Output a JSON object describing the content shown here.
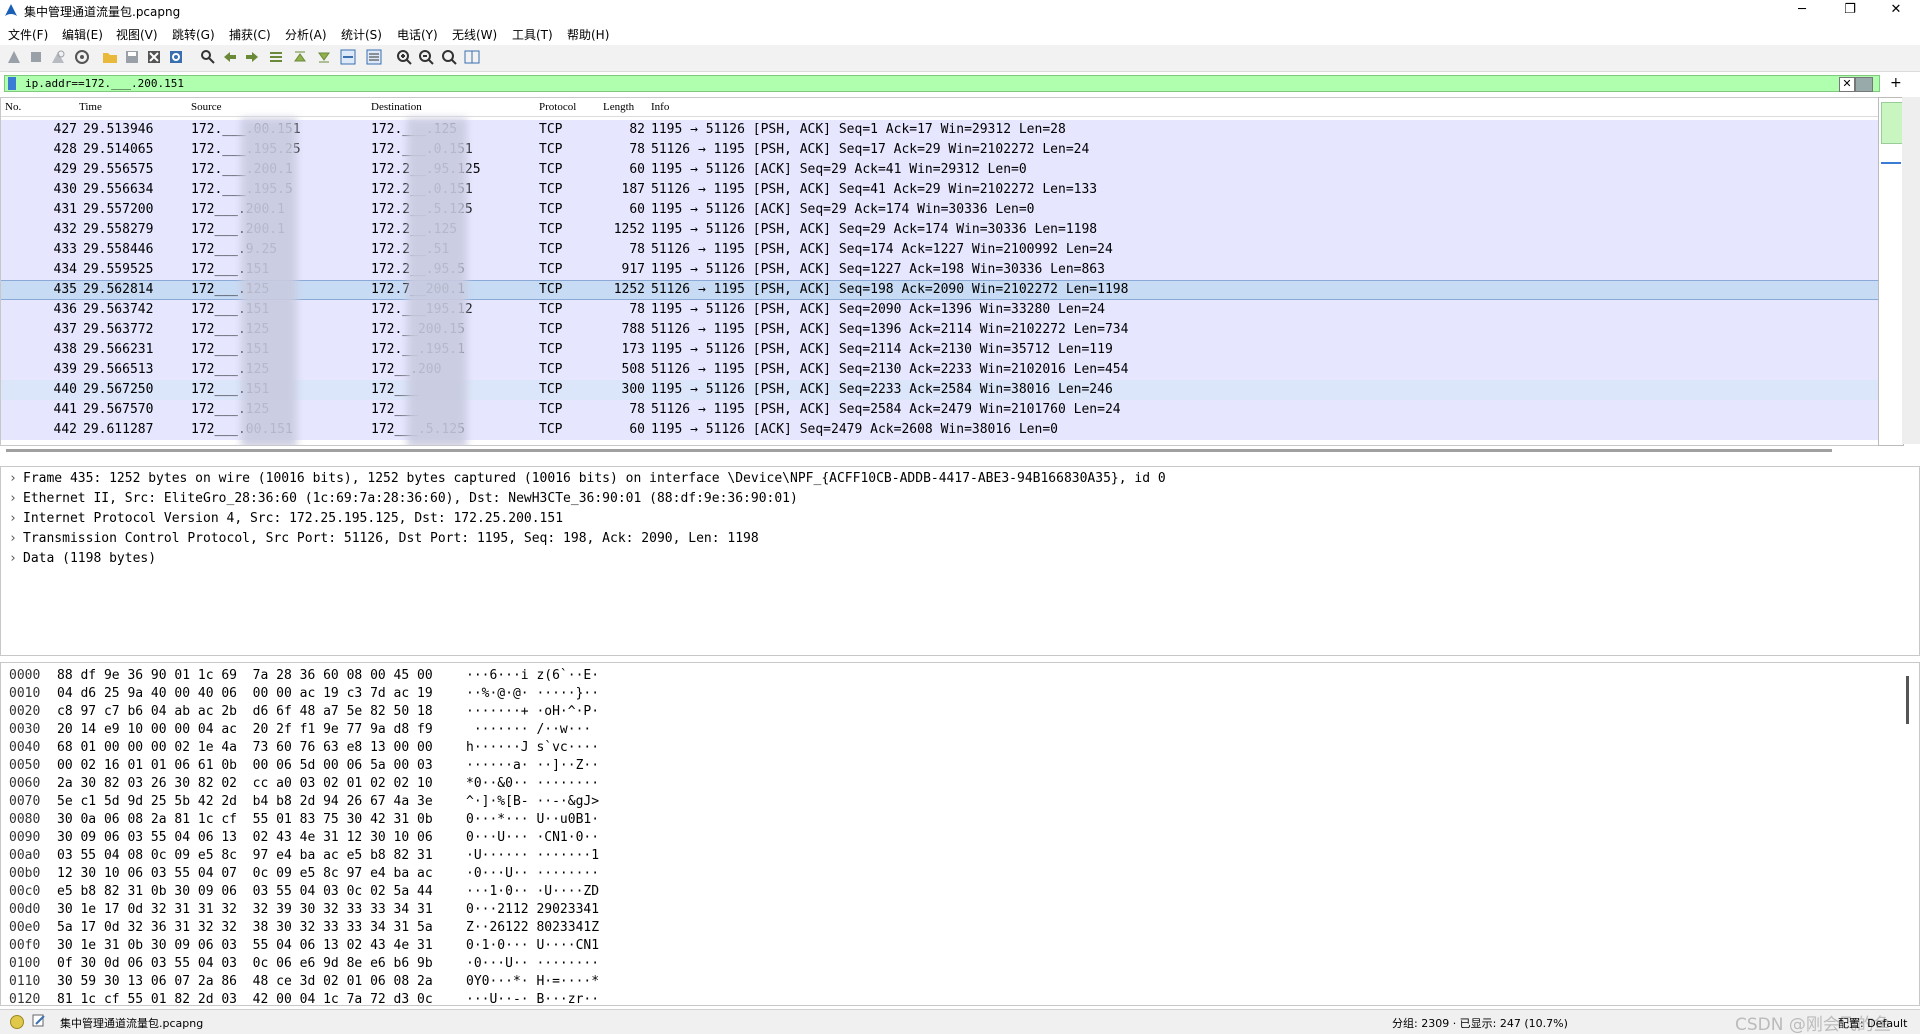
{
  "window": {
    "title": "集中管理通道流量包.pcapng",
    "minimize": "─",
    "maximize": "❐",
    "close": "✕"
  },
  "menu": [
    "文件(F)",
    "编辑(E)",
    "视图(V)",
    "跳转(G)",
    "捕获(C)",
    "分析(A)",
    "统计(S)",
    "电话(Y)",
    "无线(W)",
    "工具(T)",
    "帮助(H)"
  ],
  "toolbar_icons": [
    "shark-fin-start-icon",
    "stop-icon",
    "restart-icon",
    "options-gear-icon",
    "open-folder-icon",
    "save-file-icon",
    "close-file-icon",
    "reload-icon",
    "find-icon",
    "go-back-icon",
    "go-forward-icon",
    "go-to-packet-icon",
    "first-packet-icon",
    "last-packet-icon",
    "autoscroll-icon",
    "colorize-icon",
    "zoom-in-icon",
    "zoom-out-icon",
    "zoom-normal-icon",
    "resize-columns-icon"
  ],
  "filter": {
    "value": "ip.addr==172.___.200.151",
    "clear": "✕"
  },
  "packet_list": {
    "columns": [
      "No.",
      "Time",
      "Source",
      "Destination",
      "Protocol",
      "Length",
      "Info"
    ],
    "rows": [
      {
        "no": "427",
        "time": "29.513946",
        "src": "172.___.00.151",
        "dst": "172.___.125",
        "proto": "TCP",
        "len": "82",
        "info": "1195 → 51126 [PSH, ACK] Seq=1 Ack=17 Win=29312 Len=28"
      },
      {
        "no": "428",
        "time": "29.514065",
        "src": "172.___.195.25",
        "dst": "172.___.0.151",
        "proto": "TCP",
        "len": "78",
        "info": "51126 → 1195 [PSH, ACK] Seq=17 Ack=29 Win=2102272 Len=24"
      },
      {
        "no": "429",
        "time": "29.556575",
        "src": "172.___.200.1",
        "dst": "172.2__.95.125",
        "proto": "TCP",
        "len": "60",
        "info": "1195 → 51126 [ACK] Seq=29 Ack=41 Win=29312 Len=0"
      },
      {
        "no": "430",
        "time": "29.556634",
        "src": "172.___.195.5",
        "dst": "172.2__.0.151",
        "proto": "TCP",
        "len": "187",
        "info": "51126 → 1195 [PSH, ACK] Seq=41 Ack=29 Win=2102272 Len=133"
      },
      {
        "no": "431",
        "time": "29.557200",
        "src": "172___.200.1",
        "dst": "172.2__.5.125",
        "proto": "TCP",
        "len": "60",
        "info": "1195 → 51126 [ACK] Seq=29 Ack=174 Win=30336 Len=0"
      },
      {
        "no": "432",
        "time": "29.558279",
        "src": "172___.200.1",
        "dst": "172.2__.125",
        "proto": "TCP",
        "len": "1252",
        "info": "1195 → 51126 [PSH, ACK] Seq=29 Ack=174 Win=30336 Len=1198"
      },
      {
        "no": "433",
        "time": "29.558446",
        "src": "172___.9.25",
        "dst": "172.2__.51",
        "proto": "TCP",
        "len": "78",
        "info": "51126 → 1195 [PSH, ACK] Seq=174 Ack=1227 Win=2100992 Len=24"
      },
      {
        "no": "434",
        "time": "29.559525",
        "src": "172___.151",
        "dst": "172.2__.95.5",
        "proto": "TCP",
        "len": "917",
        "info": "1195 → 51126 [PSH, ACK] Seq=1227 Ack=198 Win=30336 Len=863"
      },
      {
        "no": "435",
        "time": "29.562814",
        "src": "172___.125",
        "dst": "172.7__200.1",
        "proto": "TCP",
        "len": "1252",
        "info": "51126 → 1195 [PSH, ACK] Seq=198 Ack=2090 Win=2102272 Len=1198"
      },
      {
        "no": "436",
        "time": "29.563742",
        "src": "172___.151",
        "dst": "172.___195.12",
        "proto": "TCP",
        "len": "78",
        "info": "1195 → 51126 [PSH, ACK] Seq=2090 Ack=1396 Win=33280 Len=24"
      },
      {
        "no": "437",
        "time": "29.563772",
        "src": "172___.125",
        "dst": "172.__200.15",
        "proto": "TCP",
        "len": "788",
        "info": "51126 → 1195 [PSH, ACK] Seq=1396 Ack=2114 Win=2102272 Len=734"
      },
      {
        "no": "438",
        "time": "29.566231",
        "src": "172___.151",
        "dst": "172.__.195.1",
        "proto": "TCP",
        "len": "173",
        "info": "1195 → 51126 [PSH, ACK] Seq=2114 Ack=2130 Win=35712 Len=119"
      },
      {
        "no": "439",
        "time": "29.566513",
        "src": "172___.125",
        "dst": "172__.200",
        "proto": "TCP",
        "len": "508",
        "info": "51126 → 1195 [PSH, ACK] Seq=2130 Ack=2233 Win=2102016 Len=454"
      },
      {
        "no": "440",
        "time": "29.567250",
        "src": "172___.151",
        "dst": "172___",
        "proto": "TCP",
        "len": "300",
        "info": "1195 → 51126 [PSH, ACK] Seq=2233 Ack=2584 Win=38016 Len=246"
      },
      {
        "no": "441",
        "time": "29.567570",
        "src": "172___.125",
        "dst": "172___",
        "proto": "TCP",
        "len": "78",
        "info": "51126 → 1195 [PSH, ACK] Seq=2584 Ack=2479 Win=2101760 Len=24"
      },
      {
        "no": "442",
        "time": "29.611287",
        "src": "172___.00.151",
        "dst": "172___.5.125",
        "proto": "TCP",
        "len": "60",
        "info": "1195 → 51126 [ACK] Seq=2479 Ack=2608 Win=38016 Len=0"
      }
    ]
  },
  "details": [
    "Frame 435: 1252 bytes on wire (10016 bits), 1252 bytes captured (10016 bits) on interface \\Device\\NPF_{ACFF10CB-ADDB-4417-ABE3-94B166830A35}, id 0",
    "Ethernet II, Src: EliteGro_28:36:60 (1c:69:7a:28:36:60), Dst: NewH3CTe_36:90:01 (88:df:9e:36:90:01)",
    "Internet Protocol Version 4, Src: 172.25.195.125, Dst: 172.25.200.151",
    "Transmission Control Protocol, Src Port: 51126, Dst Port: 1195, Seq: 198, Ack: 2090, Len: 1198",
    "Data (1198 bytes)"
  ],
  "bytes": [
    {
      "off": "0000",
      "hex": "88 df 9e 36 90 01 1c 69  7a 28 36 60 08 00 45 00",
      "asc": "···6···i z(6`··E·"
    },
    {
      "off": "0010",
      "hex": "04 d6 25 9a 40 00 40 06  00 00 ac 19 c3 7d ac 19",
      "asc": "··%·@·@· ·····}··"
    },
    {
      "off": "0020",
      "hex": "c8 97 c7 b6 04 ab ac 2b  d6 6f 48 a7 5e 82 50 18",
      "asc": "·······+ ·oH·^·P·"
    },
    {
      "off": "0030",
      "hex": "20 14 e9 10 00 00 04 ac  20 2f f1 9e 77 9a d8 f9",
      "asc": " ······· /··w···"
    },
    {
      "off": "0040",
      "hex": "68 01 00 00 00 02 1e 4a  73 60 76 63 e8 13 00 00",
      "asc": "h······J s`vc····"
    },
    {
      "off": "0050",
      "hex": "00 02 16 01 01 06 61 0b  00 06 5d 00 06 5a 00 03",
      "asc": "······a· ··]··Z··"
    },
    {
      "off": "0060",
      "hex": "2a 30 82 03 26 30 82 02  cc a0 03 02 01 02 02 10",
      "asc": "*0··&0·· ········"
    },
    {
      "off": "0070",
      "hex": "5e c1 5d 9d 25 5b 42 2d  b4 b8 2d 94 26 67 4a 3e",
      "asc": "^·]·%[B- ··-·&gJ>"
    },
    {
      "off": "0080",
      "hex": "30 0a 06 08 2a 81 1c cf  55 01 83 75 30 42 31 0b",
      "asc": "0···*··· U··u0B1·"
    },
    {
      "off": "0090",
      "hex": "30 09 06 03 55 04 06 13  02 43 4e 31 12 30 10 06",
      "asc": "0···U··· ·CN1·0··"
    },
    {
      "off": "00a0",
      "hex": "03 55 04 08 0c 09 e5 8c  97 e4 ba ac e5 b8 82 31",
      "asc": "·U······ ·······1"
    },
    {
      "off": "00b0",
      "hex": "12 30 10 06 03 55 04 07  0c 09 e5 8c 97 e4 ba ac",
      "asc": "·0···U·· ········"
    },
    {
      "off": "00c0",
      "hex": "e5 b8 82 31 0b 30 09 06  03 55 04 03 0c 02 5a 44",
      "asc": "···1·0·· ·U····ZD"
    },
    {
      "off": "00d0",
      "hex": "30 1e 17 0d 32 31 31 32  32 39 30 32 33 33 34 31",
      "asc": "0···2112 29023341"
    },
    {
      "off": "00e0",
      "hex": "5a 17 0d 32 36 31 32 32  38 30 32 33 33 34 31 5a",
      "asc": "Z··26122 8023341Z"
    },
    {
      "off": "00f0",
      "hex": "30 1e 31 0b 30 09 06 03  55 04 06 13 02 43 4e 31",
      "asc": "0·1·0··· U····CN1"
    },
    {
      "off": "0100",
      "hex": "0f 30 0d 06 03 55 04 03  0c 06 e6 9d 8e e6 b6 9b",
      "asc": "·0···U·· ········"
    },
    {
      "off": "0110",
      "hex": "30 59 30 13 06 07 2a 86  48 ce 3d 02 01 06 08 2a",
      "asc": "0Y0···*· H·=····*"
    },
    {
      "off": "0120",
      "hex": "81 1c cf 55 01 82 2d 03  42 00 04 1c 7a 72 d3 0c",
      "asc": "···U··-· B···zr··"
    }
  ],
  "status": {
    "file": "集中管理通道流量包.pcapng",
    "packets": "分组: 2309 · 已显示: 247 (10.7%)",
    "profile": "配置: Default",
    "watermark": "CSDN @刚会飞的鱼"
  },
  "colors": {
    "row_bg": "#e7e6ff",
    "selected_row": "#c7dbf5",
    "filter_valid": "#afffaf"
  }
}
